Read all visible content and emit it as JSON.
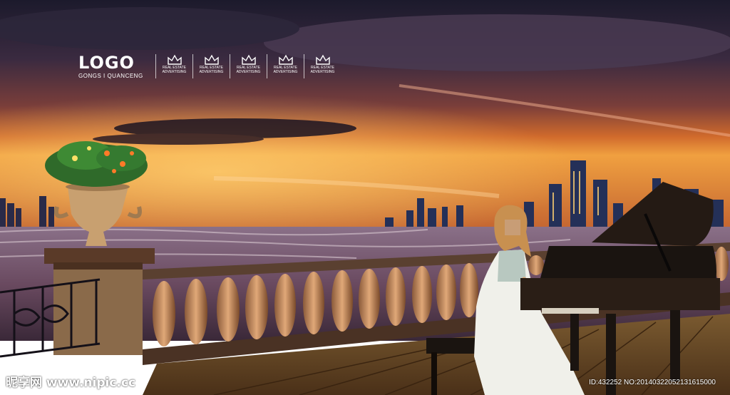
{
  "logo": {
    "title": "LOGO",
    "subtitle": "GONGS I QUANCENG"
  },
  "badges": [
    {
      "icon": "crown-icon",
      "line1": "REAL ESTATE",
      "line2": "ADVERTISING"
    },
    {
      "icon": "crown-icon",
      "line1": "REAL ESTATE",
      "line2": "ADVERTISING"
    },
    {
      "icon": "crown-icon",
      "line1": "REAL ESTATE",
      "line2": "ADVERTISING"
    },
    {
      "icon": "crown-icon",
      "line1": "REAL ESTATE",
      "line2": "ADVERTISING"
    },
    {
      "icon": "crown-icon",
      "line1": "REAL ESTATE",
      "line2": "ADVERTISING"
    }
  ],
  "watermark": {
    "site": "昵享网 www.nipic.cc",
    "id": "ID:432252 NO:20140322052131615000"
  }
}
